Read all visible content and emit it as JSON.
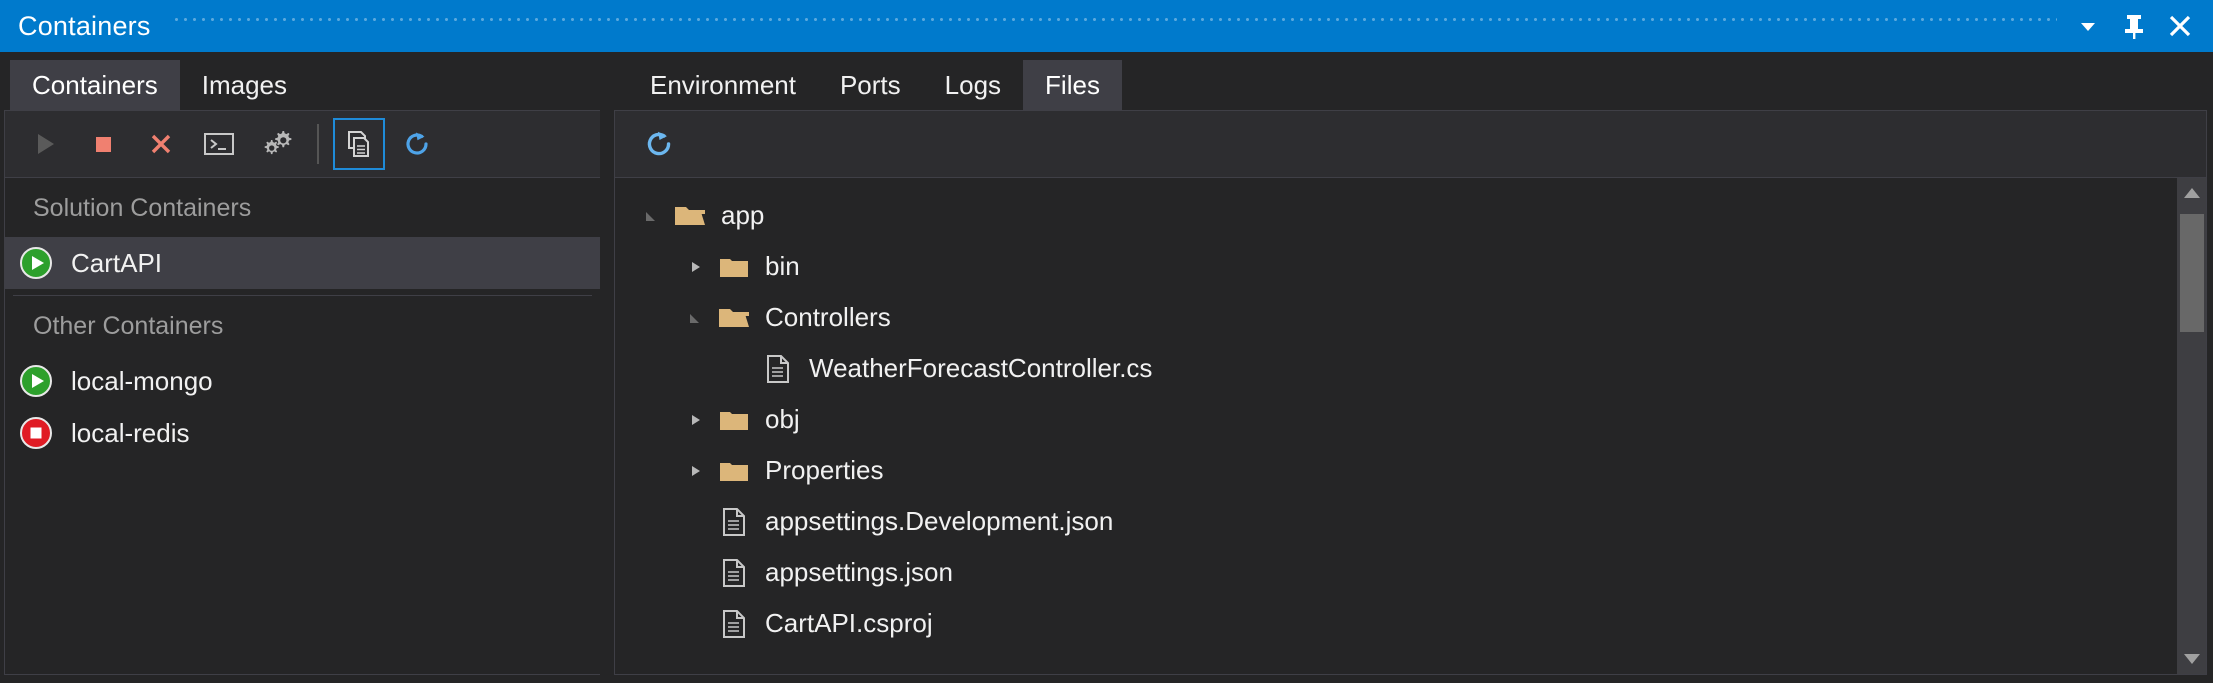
{
  "window": {
    "title": "Containers",
    "controls": [
      {
        "name": "window-dropdown-button",
        "icon": "chevron-down-icon",
        "label": "Window options"
      },
      {
        "name": "auto-hide-button",
        "icon": "pin-icon",
        "label": "Auto Hide"
      },
      {
        "name": "close-button",
        "icon": "close-icon",
        "label": "Close"
      }
    ]
  },
  "left": {
    "tabs": [
      {
        "label": "Containers",
        "active": true
      },
      {
        "label": "Images",
        "active": false
      }
    ],
    "toolbar": [
      {
        "name": "start-button",
        "icon": "play-icon",
        "label": "Start",
        "enabled": false
      },
      {
        "name": "stop-button",
        "icon": "stop-icon",
        "label": "Stop",
        "enabled": true
      },
      {
        "name": "remove-button",
        "icon": "close-x-icon",
        "label": "Remove",
        "enabled": true
      },
      {
        "name": "terminal-button",
        "icon": "terminal-icon",
        "label": "Open Terminal",
        "enabled": true
      },
      {
        "name": "settings-button",
        "icon": "gears-icon",
        "label": "Settings",
        "enabled": true
      },
      {
        "name": "files-view-button",
        "icon": "copy-files-icon",
        "label": "Files",
        "enabled": true,
        "selected": true
      },
      {
        "name": "refresh-button",
        "icon": "refresh-icon",
        "label": "Refresh",
        "enabled": true
      }
    ],
    "groups": [
      {
        "header": "Solution Containers",
        "items": [
          {
            "label": "CartAPI",
            "status": "running",
            "selected": true
          }
        ]
      },
      {
        "header": "Other Containers",
        "items": [
          {
            "label": "local-mongo",
            "status": "running",
            "selected": false
          },
          {
            "label": "local-redis",
            "status": "stopped",
            "selected": false
          }
        ]
      }
    ]
  },
  "right": {
    "tabs": [
      {
        "label": "Environment",
        "active": false
      },
      {
        "label": "Ports",
        "active": false
      },
      {
        "label": "Logs",
        "active": false
      },
      {
        "label": "Files",
        "active": true
      }
    ],
    "toolbar": [
      {
        "name": "files-refresh-button",
        "icon": "refresh-icon",
        "label": "Refresh"
      }
    ],
    "tree": [
      {
        "label": "app",
        "type": "folder",
        "state": "expanded",
        "depth": 0
      },
      {
        "label": "bin",
        "type": "folder",
        "state": "collapsed",
        "depth": 1
      },
      {
        "label": "Controllers",
        "type": "folder",
        "state": "expanded",
        "depth": 1
      },
      {
        "label": "WeatherForecastController.cs",
        "type": "file",
        "state": "leaf",
        "depth": 2
      },
      {
        "label": "obj",
        "type": "folder",
        "state": "collapsed",
        "depth": 1
      },
      {
        "label": "Properties",
        "type": "folder",
        "state": "collapsed",
        "depth": 1
      },
      {
        "label": "appsettings.Development.json",
        "type": "file",
        "state": "leaf",
        "depth": 1
      },
      {
        "label": "appsettings.json",
        "type": "file",
        "state": "leaf",
        "depth": 1
      },
      {
        "label": "CartAPI.csproj",
        "type": "file",
        "state": "leaf",
        "depth": 1
      }
    ],
    "scrollbar": {
      "name": "vertical-scrollbar",
      "up": "scroll-up-icon",
      "down": "scroll-down-icon"
    }
  },
  "colors": {
    "titlebar": "#007acc",
    "background": "#252526",
    "panel": "#2d2d30",
    "selection": "#3f3f46",
    "border": "#3f3f46",
    "text": "#f1f1f1",
    "muted": "#9d9d9d",
    "folder": "#dcb67a",
    "running": "#2da02c",
    "stopped": "#e01b24",
    "accent_blue": "#4ea3e8",
    "danger": "#f08070"
  }
}
